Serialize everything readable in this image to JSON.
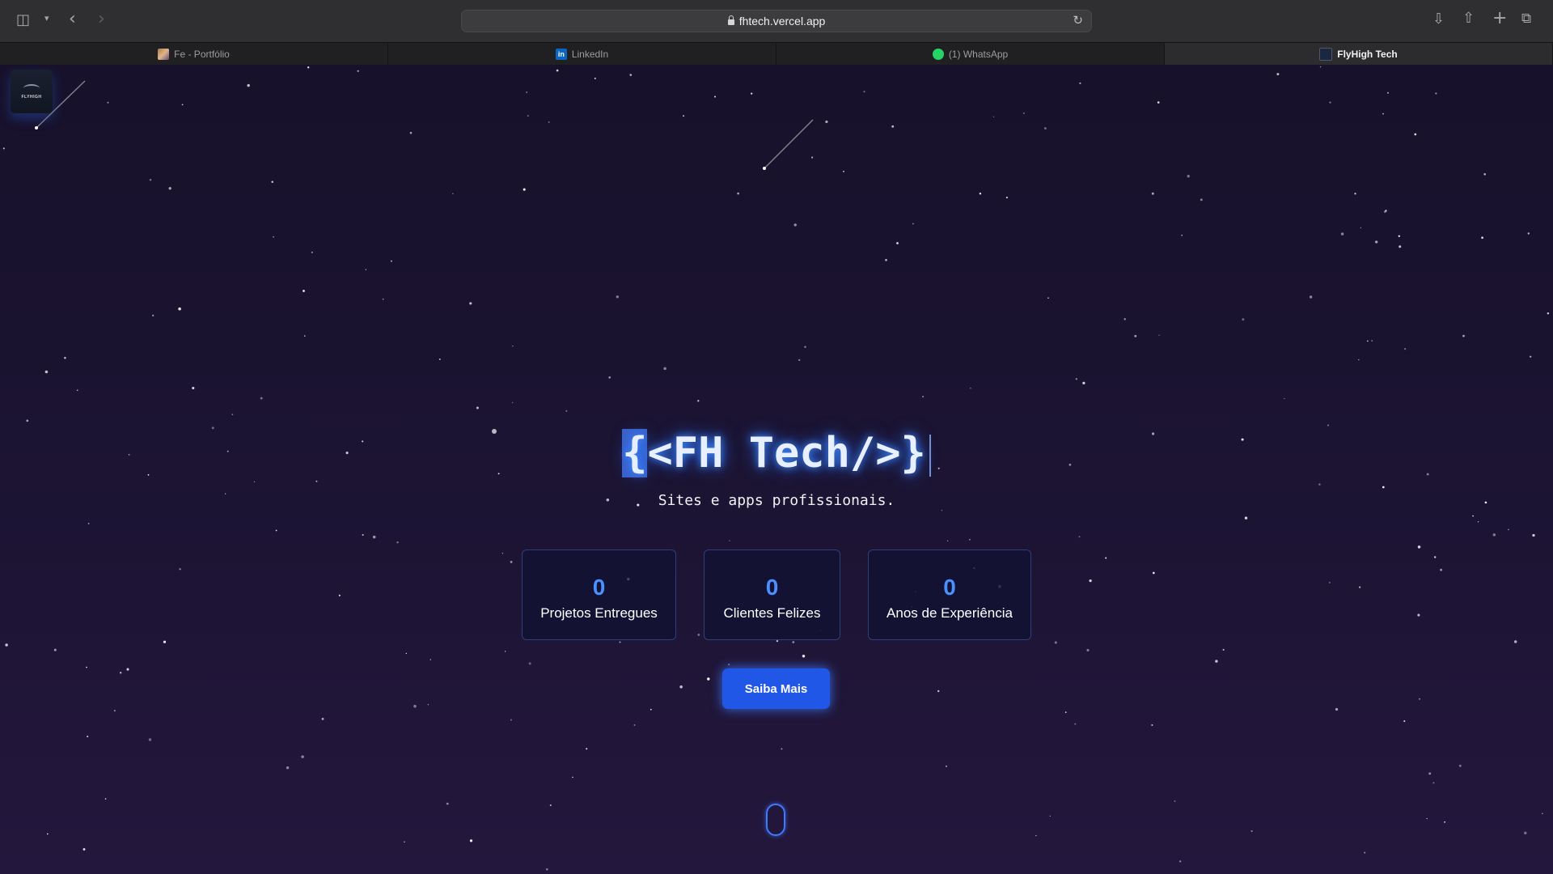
{
  "browser": {
    "url": "fhtech.vercel.app",
    "tabs": [
      {
        "label": "Fe - Portfólio",
        "icon": "portfolio-favicon"
      },
      {
        "label": "LinkedIn",
        "icon": "linkedin-favicon"
      },
      {
        "label": "(1) WhatsApp",
        "icon": "whatsapp-favicon"
      },
      {
        "label": "FlyHigh Tech",
        "icon": "flyhigh-favicon",
        "active": true
      }
    ]
  },
  "logo": {
    "text": "FLYHIGH"
  },
  "hero": {
    "title_selected": "{",
    "title_rest": "<FH Tech/>}",
    "subtitle": "Sites e apps profissionais."
  },
  "stats": [
    {
      "value": "0",
      "label": "Projetos Entregues"
    },
    {
      "value": "0",
      "label": "Clientes Felizes"
    },
    {
      "value": "0",
      "label": "Anos de Experiência"
    }
  ],
  "cta": {
    "label": "Saiba Mais"
  },
  "colors": {
    "accent": "#2157e6",
    "glow": "#3f8cff",
    "stat_number": "#4a90ff",
    "background": "#1c1433"
  }
}
